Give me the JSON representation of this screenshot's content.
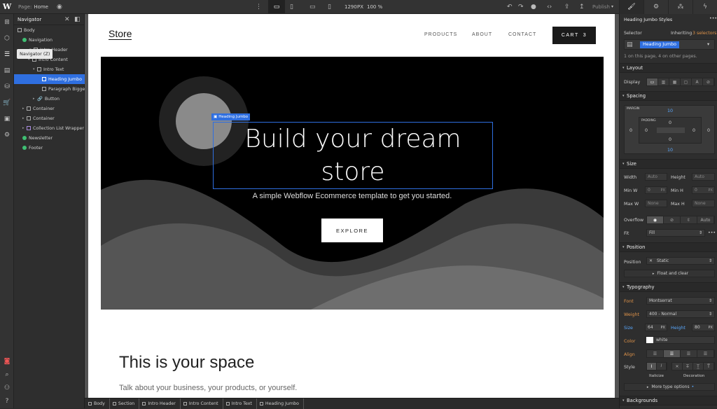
{
  "topbar": {
    "page_label": "Page:",
    "page_name": "Home",
    "viewport_width": "1290",
    "viewport_unit": "PX",
    "zoom": "100 %",
    "publish_label": "Publish"
  },
  "rail": {
    "tooltip": "Navigator (Z)"
  },
  "navigator": {
    "title": "Navigator",
    "items": [
      {
        "label": "Body",
        "kind": "box"
      },
      {
        "label": "Navigation",
        "kind": "dot"
      },
      {
        "label": "Intro Header",
        "kind": "box"
      },
      {
        "label": "Intro Content",
        "kind": "box"
      },
      {
        "label": "Intro Text",
        "kind": "box"
      },
      {
        "label": "Heading Jumbo",
        "kind": "text"
      },
      {
        "label": "Paragraph Bigger",
        "kind": "text"
      },
      {
        "label": "Button",
        "kind": "link"
      },
      {
        "label": "Container",
        "kind": "box"
      },
      {
        "label": "Container",
        "kind": "box"
      },
      {
        "label": "Collection List Wrapper",
        "kind": "collection"
      },
      {
        "label": "Newsletter",
        "kind": "dot"
      },
      {
        "label": "Footer",
        "kind": "dot"
      }
    ]
  },
  "site": {
    "logo": "Store",
    "menu": [
      "PRODUCTS",
      "ABOUT",
      "CONTACT"
    ],
    "cart_label": "CART",
    "cart_count": "3",
    "hero_tag": "Heading Jumbo",
    "headline": "Build your dream store",
    "subhead": "A simple Webflow Ecommerce template to get you started.",
    "cta": "EXPLORE",
    "section_title": "This is your space",
    "section_sub": "Talk about your business, your products, or yourself."
  },
  "breadcrumbs": [
    "Body",
    "Section",
    "Intro Header",
    "Intro Content",
    "Intro Text",
    "Heading Jumbo"
  ],
  "panel": {
    "title": "Heading Jumbo Styles",
    "selector_label": "Selector",
    "inheriting_text": "Inheriting",
    "inheriting_count": "3 selectors",
    "selector_chip": "Heading Jumbo",
    "usage_note": "1 on this page, 4 on other pages.",
    "layout": {
      "title": "Layout",
      "display_label": "Display"
    },
    "spacing": {
      "title": "Spacing",
      "margin_label": "MARGIN",
      "padding_label": "PADDING",
      "margin_top": "10",
      "margin_bottom": "10",
      "margin_left": "0",
      "margin_right": "0",
      "padding_top": "0",
      "padding_bottom": "0",
      "padding_left": "0",
      "padding_right": "0"
    },
    "size": {
      "title": "Size",
      "width_label": "Width",
      "width_value": "Auto",
      "height_label": "Height",
      "height_value": "Auto",
      "minw_label": "Min W",
      "minw_value": "0",
      "minw_unit": "PX",
      "minh_label": "Min H",
      "minh_value": "0",
      "minh_unit": "PX",
      "maxw_label": "Max W",
      "maxw_value": "None",
      "maxh_label": "Max H",
      "maxh_value": "None",
      "overflow_label": "Overflow",
      "overflow_auto": "Auto",
      "fit_label": "Fit",
      "fit_value": "Fill"
    },
    "position": {
      "title": "Position",
      "label": "Position",
      "value": "Static",
      "float_label": "Float and clear"
    },
    "typography": {
      "title": "Typography",
      "font_label": "Font",
      "font_value": "Montserrat",
      "weight_label": "Weight",
      "weight_value": "400 - Normal",
      "size_label": "Size",
      "size_value": "64",
      "size_unit": "PX",
      "height_label": "Height",
      "height_value": "80",
      "height_unit": "PX",
      "color_label": "Color",
      "color_value": "white",
      "color_hex": "#ffffff",
      "align_label": "Align",
      "style_label": "Style",
      "italicize_label": "Italicize",
      "decoration_label": "Decoration",
      "more_options": "More type options"
    },
    "backgrounds": {
      "title": "Backgrounds"
    }
  },
  "colors": {
    "accent": "#2f6fe0",
    "orange": "#e0944a"
  }
}
